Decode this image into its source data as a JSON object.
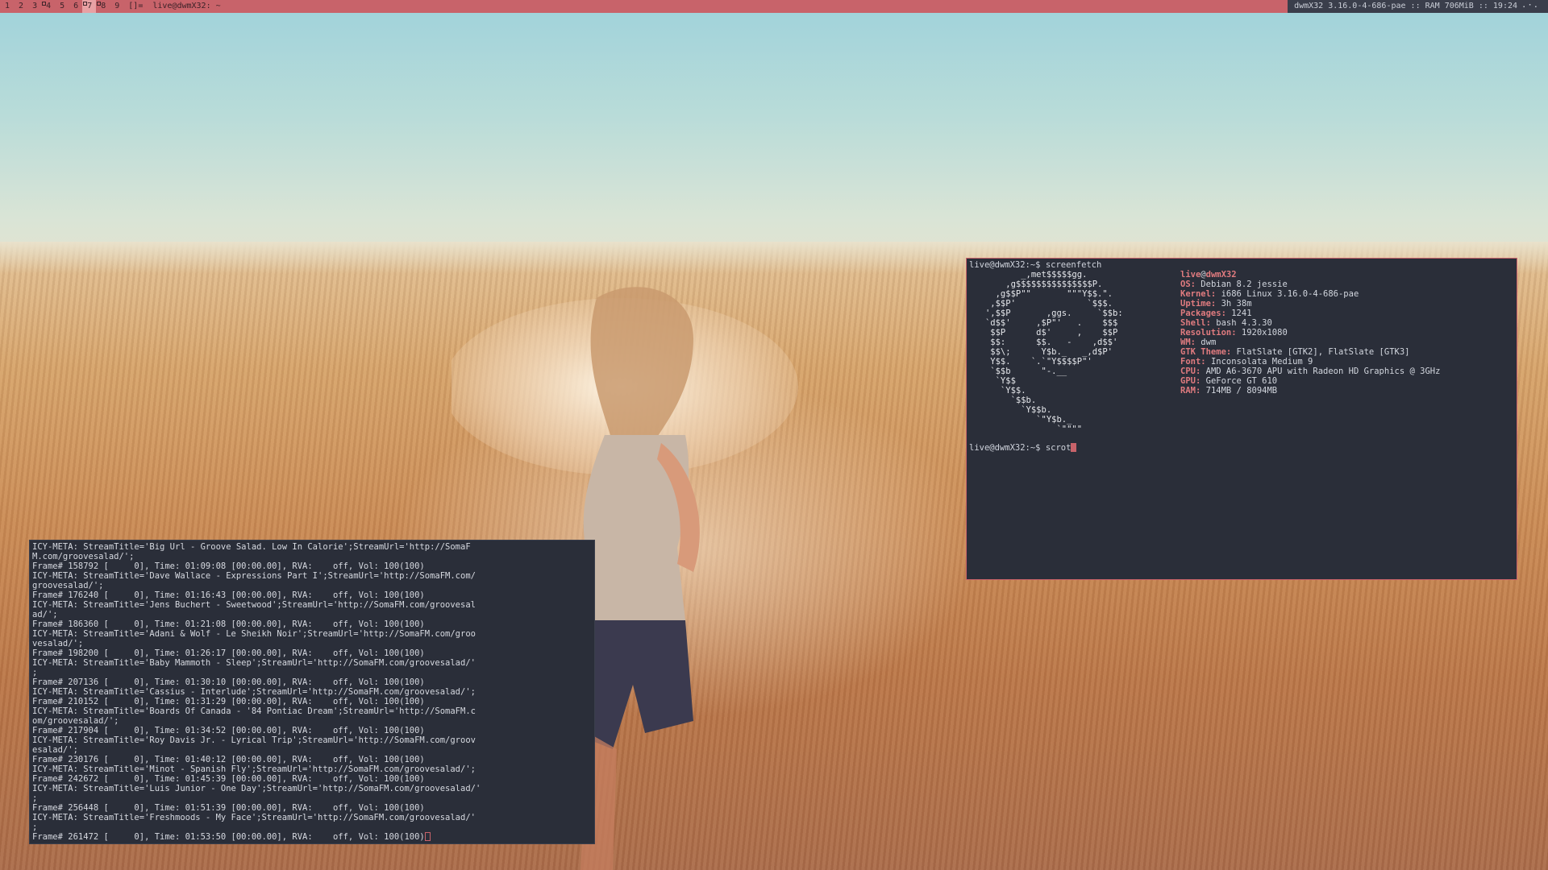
{
  "topbar": {
    "tags": [
      {
        "label": "1",
        "occupied": false,
        "selected": false
      },
      {
        "label": "2",
        "occupied": false,
        "selected": false
      },
      {
        "label": "3",
        "occupied": false,
        "selected": false
      },
      {
        "label": "4",
        "occupied": true,
        "selected": false
      },
      {
        "label": "5",
        "occupied": false,
        "selected": false
      },
      {
        "label": "6",
        "occupied": false,
        "selected": false
      },
      {
        "label": "7",
        "occupied": true,
        "selected": true
      },
      {
        "label": "8",
        "occupied": true,
        "selected": false
      },
      {
        "label": "9",
        "occupied": false,
        "selected": false
      }
    ],
    "layout_symbol": "[]=",
    "window_title": "live@dwmX32: ~",
    "status": "dwmX32 3.16.0-4-686-pae :: RAM 706MiB :: 19:24 ⠄⠂⠄"
  },
  "colors": {
    "bar": "#c8636a",
    "terminal_bg": "#2a2e39",
    "accent": "#e07b7f"
  },
  "fetch_terminal": {
    "command_line": "live@dwmX32:~$ screenfetch",
    "ascii_logo": [
      "          _,met$$$$$gg.",
      "       ,g$$$$$$$$$$$$$$$P.",
      "     ,g$$P\"\"       \"\"\"Y$$.\".",
      "    ,$$P'              `$$$.",
      "   ',$$P       ,ggs.     `$$b:",
      "   `d$$'     ,$P\"'   .    $$$",
      "    $$P      d$'     ,    $$P",
      "    $$:      $$.   -    ,d$$'",
      "    $$\\;      Y$b._   _,d$P'",
      "    Y$$.    `.`\"Y$$$$P\"'",
      "    `$$b      \"-.__",
      "     `Y$$",
      "      `Y$$.",
      "        `$$b.",
      "          `Y$$b.",
      "             `\"Y$b._",
      "                 `\"\"\"\""
    ],
    "user": "live",
    "at": "@",
    "host": "dwmX32",
    "info": [
      {
        "key": "OS:",
        "value": "Debian 8.2 jessie"
      },
      {
        "key": "Kernel:",
        "value": "i686 Linux 3.16.0-4-686-pae"
      },
      {
        "key": "Uptime:",
        "value": "3h 38m"
      },
      {
        "key": "Packages:",
        "value": "1241"
      },
      {
        "key": "Shell:",
        "value": "bash 4.3.30"
      },
      {
        "key": "Resolution:",
        "value": "1920x1080"
      },
      {
        "key": "WM:",
        "value": "dwm"
      },
      {
        "key": "GTK Theme:",
        "value": "FlatSlate [GTK2], FlatSlate [GTK3]"
      },
      {
        "key": "Font:",
        "value": "Inconsolata Medium 9"
      },
      {
        "key": "CPU:",
        "value": "AMD A6-3670 APU with Radeon HD Graphics @ 3GHz"
      },
      {
        "key": "GPU:",
        "value": "GeForce GT 610"
      },
      {
        "key": "RAM:",
        "value": "714MB / 8094MB"
      }
    ],
    "prompt_line": "live@dwmX32:~$ scrot"
  },
  "music_terminal": {
    "lines": [
      "ICY-META: StreamTitle='Big Url - Groove Salad. Low In Calorie';StreamUrl='http://SomaF",
      "M.com/groovesalad/';",
      "Frame# 158792 [     0], Time: 01:09:08 [00:00.00], RVA:    off, Vol: 100(100)",
      "ICY-META: StreamTitle='Dave Wallace - Expressions Part I';StreamUrl='http://SomaFM.com/",
      "groovesalad/';",
      "Frame# 176240 [     0], Time: 01:16:43 [00:00.00], RVA:    off, Vol: 100(100)",
      "ICY-META: StreamTitle='Jens Buchert - Sweetwood';StreamUrl='http://SomaFM.com/groovesal",
      "ad/';",
      "Frame# 186360 [     0], Time: 01:21:08 [00:00.00], RVA:    off, Vol: 100(100)",
      "ICY-META: StreamTitle='Adani & Wolf - Le Sheikh Noir';StreamUrl='http://SomaFM.com/groo",
      "vesalad/';",
      "Frame# 198200 [     0], Time: 01:26:17 [00:00.00], RVA:    off, Vol: 100(100)",
      "ICY-META: StreamTitle='Baby Mammoth - Sleep';StreamUrl='http://SomaFM.com/groovesalad/'",
      ";",
      "Frame# 207136 [     0], Time: 01:30:10 [00:00.00], RVA:    off, Vol: 100(100)",
      "ICY-META: StreamTitle='Cassius - Interlude';StreamUrl='http://SomaFM.com/groovesalad/';",
      "Frame# 210152 [     0], Time: 01:31:29 [00:00.00], RVA:    off, Vol: 100(100)",
      "ICY-META: StreamTitle='Boards Of Canada - '84 Pontiac Dream';StreamUrl='http://SomaFM.c",
      "om/groovesalad/';",
      "Frame# 217904 [     0], Time: 01:34:52 [00:00.00], RVA:    off, Vol: 100(100)",
      "ICY-META: StreamTitle='Roy Davis Jr. - Lyrical Trip';StreamUrl='http://SomaFM.com/groov",
      "esalad/';",
      "Frame# 230176 [     0], Time: 01:40:12 [00:00.00], RVA:    off, Vol: 100(100)",
      "ICY-META: StreamTitle='Minot - Spanish Fly';StreamUrl='http://SomaFM.com/groovesalad/';",
      "Frame# 242672 [     0], Time: 01:45:39 [00:00.00], RVA:    off, Vol: 100(100)",
      "ICY-META: StreamTitle='Luis Junior - One Day';StreamUrl='http://SomaFM.com/groovesalad/'",
      ";",
      "Frame# 256448 [     0], Time: 01:51:39 [00:00.00], RVA:    off, Vol: 100(100)",
      "ICY-META: StreamTitle='Freshmoods - My Face';StreamUrl='http://SomaFM.com/groovesalad/'",
      ";",
      "Frame# 261472 [     0], Time: 01:53:50 [00:00.00], RVA:    off, Vol: 100(100)"
    ]
  }
}
